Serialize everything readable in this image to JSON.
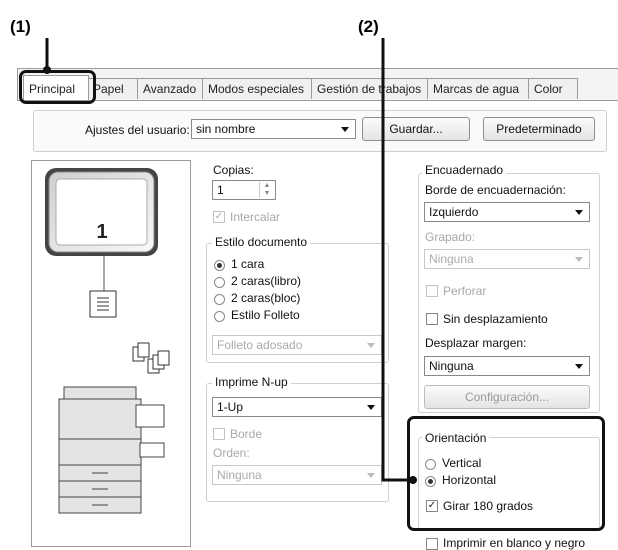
{
  "callouts": {
    "one": "(1)",
    "two": "(2)"
  },
  "tabs": [
    "Principal",
    "Papel",
    "Avanzado",
    "Modos especiales",
    "Gestión de trabajos",
    "Marcas de agua",
    "Color"
  ],
  "user_settings": {
    "label": "Ajustes del usuario:",
    "value": "sin nombre",
    "save": "Guardar...",
    "default": "Predeterminado"
  },
  "preview": {
    "page_number": "1"
  },
  "copies": {
    "label": "Copias:",
    "value": "1",
    "collate": "Intercalar"
  },
  "document_style": {
    "label": "Estilo documento",
    "options": [
      "1 cara",
      "2 caras(libro)",
      "2 caras(bloc)",
      "Estilo Folleto"
    ],
    "selected": "1 cara",
    "booklet_value": "Folleto adosado"
  },
  "nup": {
    "label": "Imprime N-up",
    "value": "1-Up",
    "border": "Borde",
    "order_label": "Orden:",
    "order_value": "Ninguna"
  },
  "binding": {
    "label": "Encuadernado",
    "edge_label": "Borde de encuadernación:",
    "edge_value": "Izquierdo",
    "staple_label": "Grapado:",
    "staple_value": "Ninguna",
    "punch": "Perforar",
    "no_shift": "Sin desplazamiento",
    "margin_label": "Desplazar margen:",
    "margin_value": "Ninguna",
    "config": "Configuración..."
  },
  "orientation": {
    "label": "Orientación",
    "options": [
      "Vertical",
      "Horizontal"
    ],
    "selected": "Horizontal",
    "rotate": "Girar 180 grados"
  },
  "print_bw": "Imprimir en blanco y negro"
}
